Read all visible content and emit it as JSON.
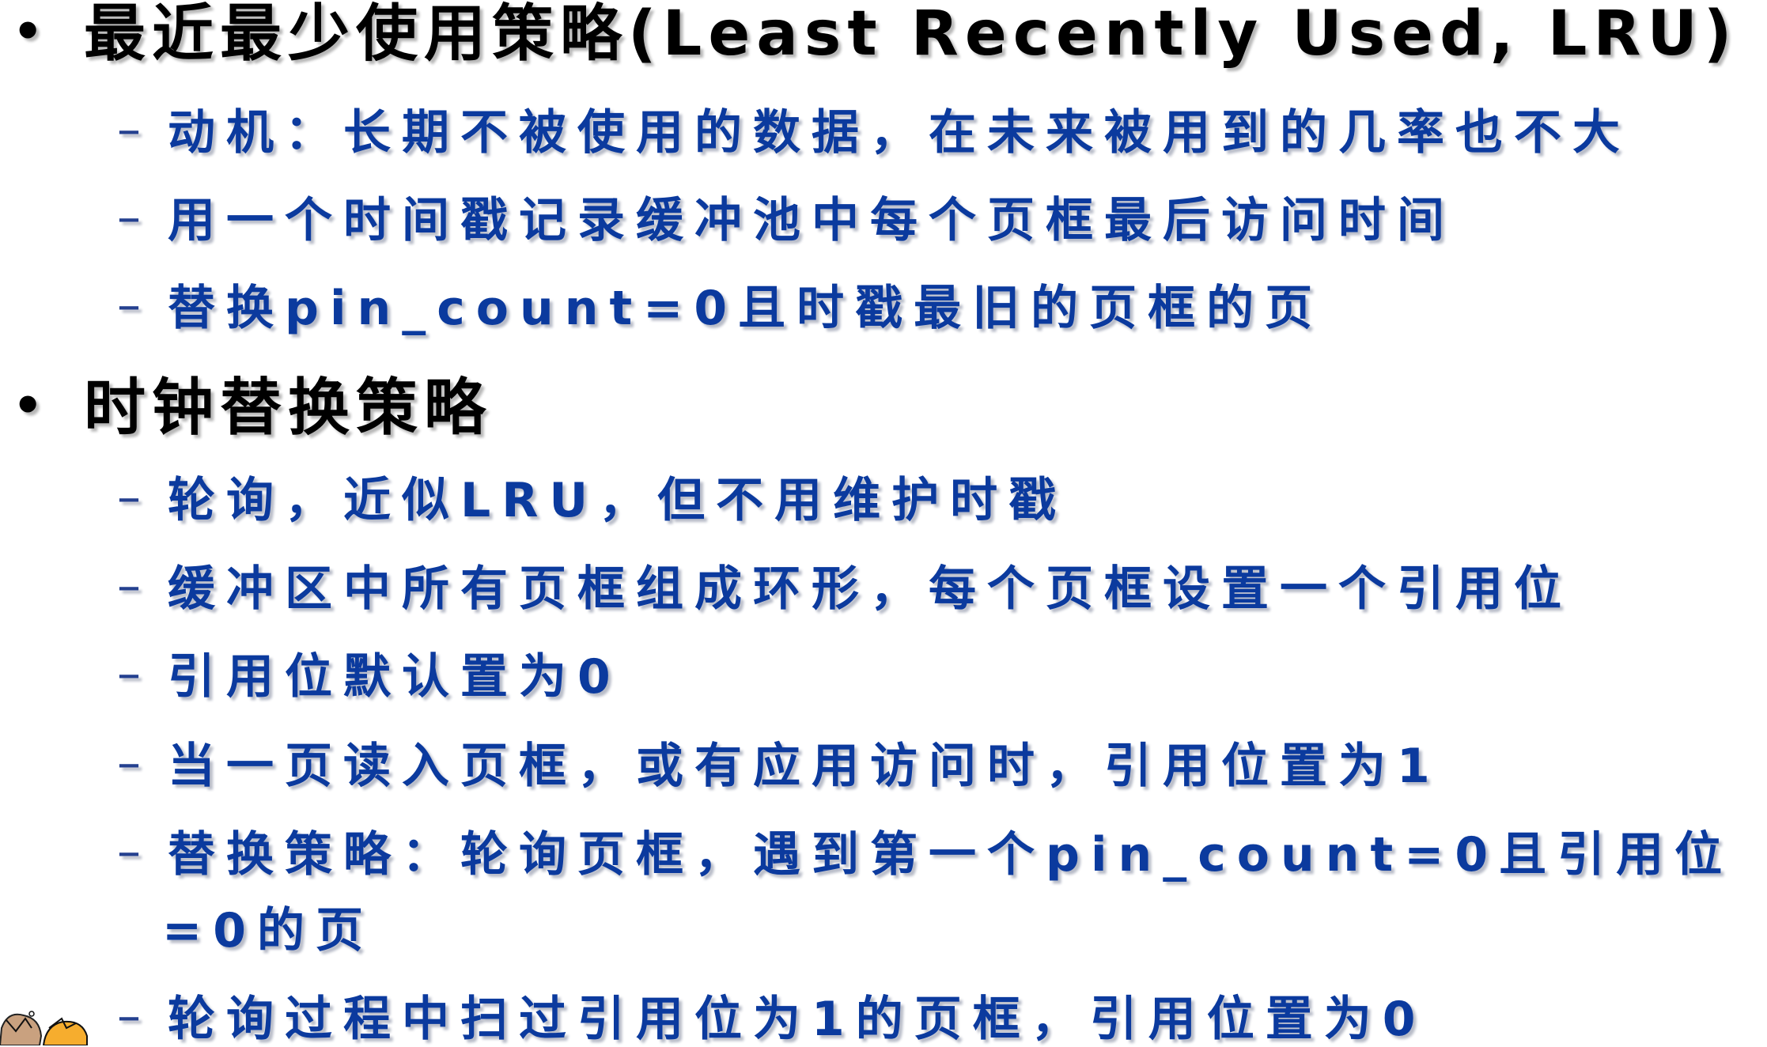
{
  "sections": [
    {
      "title": "最近最少使用策略(Least Recently Used, LRU)",
      "items": [
        "动机：长期不被使用的数据，在未来被用到的几率也不大",
        "用一个时间戳记录缓冲池中每个页框最后访问时间",
        "替换pin_count=0且时戳最旧的页框的页"
      ]
    },
    {
      "title": "时钟替换策略",
      "items": [
        "轮询，近似LRU，但不用维护时戳",
        "缓冲区中所有页框组成环形，每个页框设置一个引用位",
        "引用位默认置为0",
        "当一页读入页框，或有应用访问时，引用位置为1",
        "替换策略：轮询页框，遇到第一个pin_count=0且引用位",
        "轮询过程中扫过引用位为1的页框，引用位置为0"
      ],
      "continuation": "=0的页"
    }
  ],
  "bullet": "•",
  "dash": "–"
}
